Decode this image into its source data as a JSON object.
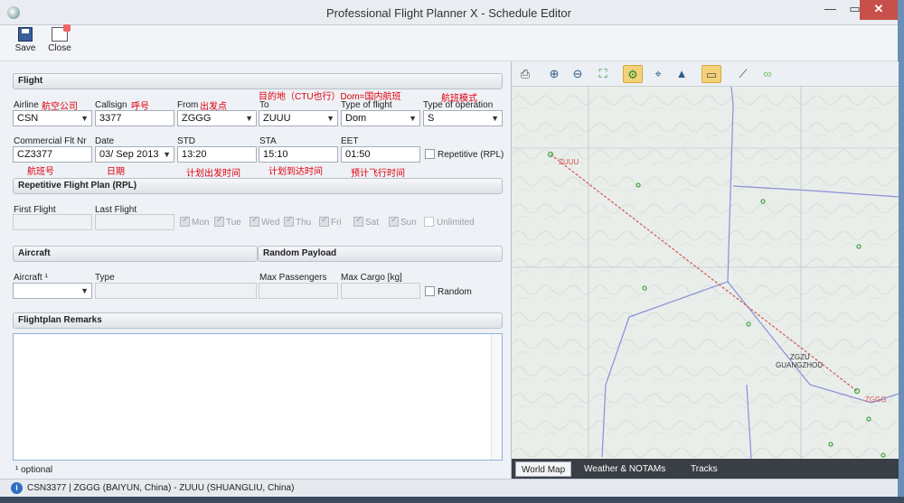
{
  "window": {
    "title": "Professional Flight Planner X - Schedule Editor",
    "min": "—",
    "max": "▭",
    "close": "✕"
  },
  "toolbar": {
    "save": "Save",
    "close": "Close"
  },
  "flight": {
    "section": "Flight",
    "airline_label": "Airline",
    "airline_note": "航空公司",
    "airline_value": "CSN",
    "callsign_label": "Callsign",
    "callsign_note": "呼号",
    "callsign_value": "3377",
    "from_label": "From",
    "from_note": "出发点",
    "from_value": "ZGGG",
    "to_label": "To",
    "to_note": "目的地（CTU也行）Dom=国内航班",
    "to_value": "ZUUU",
    "type_label": "Type of flight",
    "type_value": "Dom",
    "op_label": "Type of operation",
    "op_note": "航班模式",
    "op_value": "S",
    "cfn_label": "Commercial Flt Nr",
    "cfn_value": "CZ3377",
    "cfn_note": "航班号",
    "date_label": "Date",
    "date_value": "03/ Sep 2013",
    "date_note": "日期",
    "std_label": "STD",
    "std_value": "13:20",
    "std_note": "计划出发时间",
    "sta_label": "STA",
    "sta_value": "15:10",
    "sta_note": "计划到达时间",
    "eet_label": "EET",
    "eet_value": "01:50",
    "eet_note": "预计飞行时间",
    "repetitive": "Repetitive (RPL)"
  },
  "rpl": {
    "section": "Repetitive Flight Plan (RPL)",
    "first": "First Flight",
    "last": "Last Flight",
    "days": [
      "Mon",
      "Tue",
      "Wed",
      "Thu",
      "Fri",
      "Sat",
      "Sun"
    ],
    "unlimited": "Unlimited"
  },
  "aircraft": {
    "section": "Aircraft",
    "aircraft_label": "Aircraft ¹",
    "type_label": "Type"
  },
  "payload": {
    "section": "Random Payload",
    "pax": "Max Passengers",
    "cargo": "Max Cargo [kg]",
    "random": "Random"
  },
  "remarks": {
    "section": "Flightplan Remarks",
    "optional": "¹ optional"
  },
  "status": {
    "text": "CSN3377 | ZGGG (BAIYUN, China) - ZUUU (SHUANGLIU, China)",
    "info": "i"
  },
  "map": {
    "labels": {
      "zuuu": "ZUUU",
      "zgzu": "ZGZU",
      "guangzhou": "GUANGZHOU",
      "zggg": "ZGGG"
    },
    "tabs": [
      "World Map",
      "Weather & NOTAMs",
      "Tracks"
    ]
  },
  "colors": {
    "route": "#d9534f",
    "airport": "#4aa84a",
    "border": "#8a8fd8",
    "accent": "#f4d27a"
  }
}
